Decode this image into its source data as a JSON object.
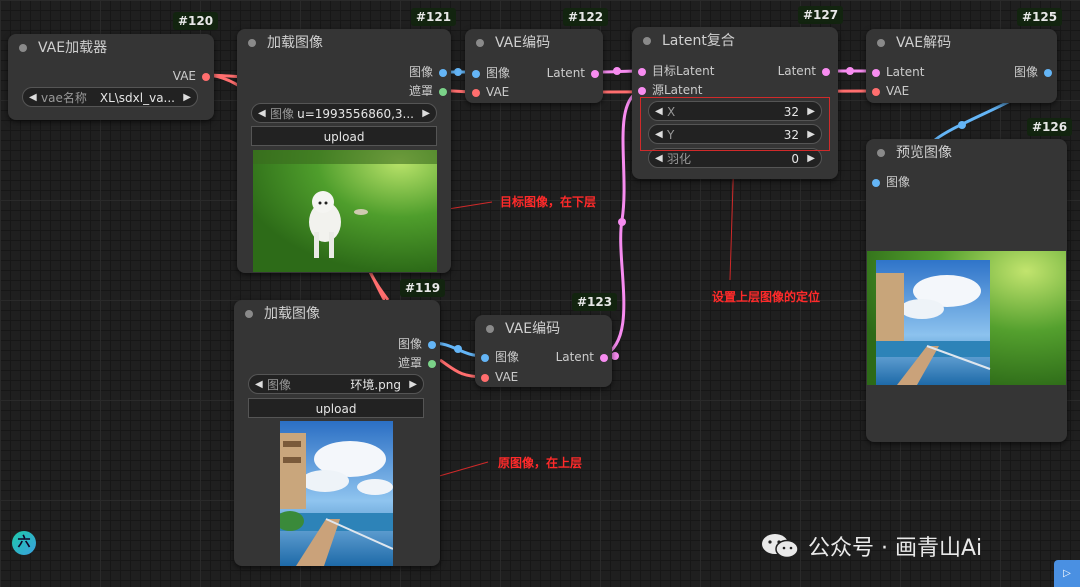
{
  "colors": {
    "image_wire": "#64b5f6",
    "vae_wire": "#ff6e6e",
    "latent_wire": "#f78cf0",
    "mask_dot": "#7bd389",
    "annotation": "#ff2a2a",
    "node_bg": "#353535",
    "canvas_bg": "#1f1f1f"
  },
  "nodes": {
    "n120": {
      "id": "#120",
      "title": "VAE加载器",
      "out_vae": "VAE",
      "widget": {
        "label": "vae名称",
        "value": "XL\\sdxl_va..."
      }
    },
    "n121": {
      "id": "#121",
      "title": "加载图像",
      "out_image": "图像",
      "out_mask": "遮罩",
      "widget": {
        "label": "图像",
        "value": "u=1993556860,3..."
      },
      "upload": "upload",
      "image_desc": "white-dog-on-grass"
    },
    "n122": {
      "id": "#122",
      "title": "VAE编码",
      "in_image": "图像",
      "in_vae": "VAE",
      "out_latent": "Latent"
    },
    "n127": {
      "id": "#127",
      "title": "Latent复合",
      "in_target": "目标Latent",
      "in_source": "源Latent",
      "out_latent": "Latent",
      "widgets": [
        {
          "label": "X",
          "value": "32"
        },
        {
          "label": "Y",
          "value": "32"
        },
        {
          "label": "羽化",
          "value": "0"
        }
      ]
    },
    "n125": {
      "id": "#125",
      "title": "VAE解码",
      "in_latent": "Latent",
      "in_vae": "VAE",
      "out_image": "图像"
    },
    "n126": {
      "id": "#126",
      "title": "预览图像",
      "in_image": "图像"
    },
    "n119": {
      "id": "#119",
      "title": "加载图像",
      "out_image": "图像",
      "out_mask": "遮罩",
      "widget": {
        "label": "图像",
        "value": "环境.png"
      },
      "upload": "upload"
    },
    "n123": {
      "id": "#123",
      "title": "VAE编码",
      "in_image": "图像",
      "in_vae": "VAE",
      "out_latent": "Latent"
    }
  },
  "annotations": {
    "target": "目标图像，在下层",
    "position": "设置上层图像的定位",
    "source": "原图像，在上层"
  },
  "watermark": "公众号 · 画青山Ai",
  "badge": "六",
  "icons": {
    "arrow_left": "◀",
    "arrow_right": "▶",
    "wechat": "wechat-icon"
  }
}
